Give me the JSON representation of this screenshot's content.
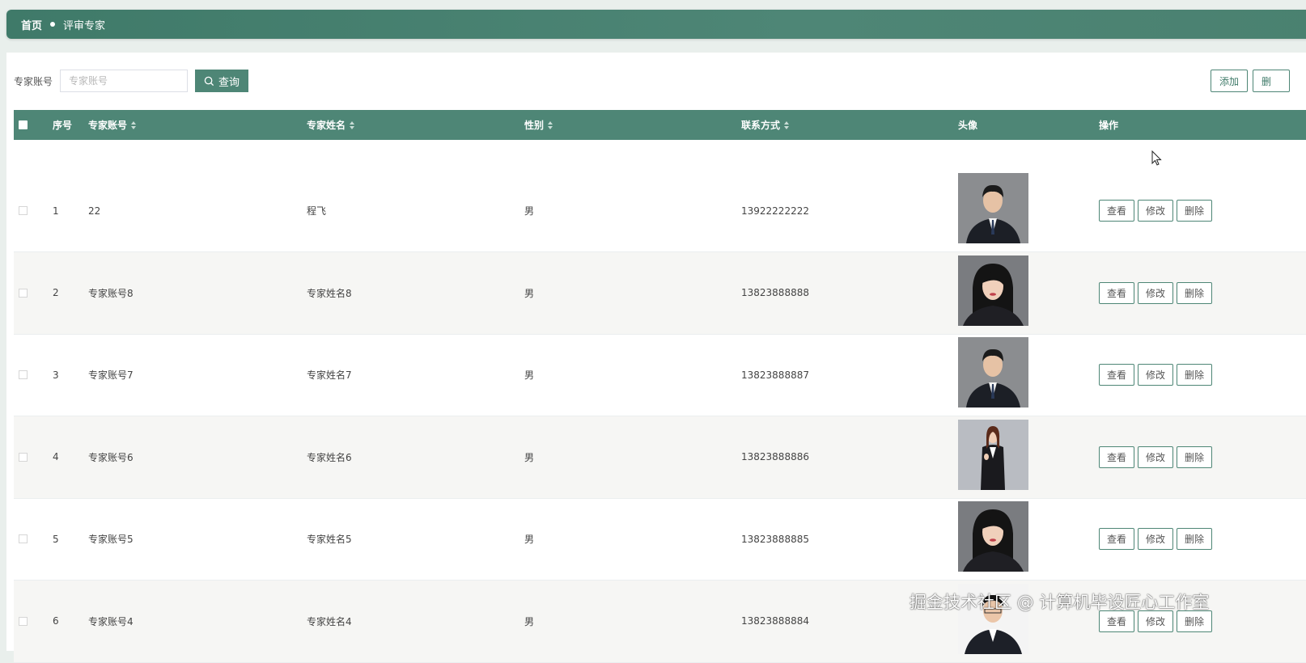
{
  "breadcrumb": {
    "home": "首页",
    "current": "评审专家"
  },
  "search": {
    "label": "专家账号",
    "placeholder": "专家账号",
    "value": "",
    "button": "查询"
  },
  "toolbar": {
    "add": "添加",
    "delete": "删"
  },
  "table": {
    "headers": {
      "index": "序号",
      "account": "专家账号",
      "name": "专家姓名",
      "gender": "性别",
      "phone": "联系方式",
      "avatar": "头像",
      "actions": "操作"
    },
    "rows": [
      {
        "index": "1",
        "account": "22",
        "name": "程飞",
        "gender": "男",
        "phone": "13922222222",
        "avatar": "male"
      },
      {
        "index": "2",
        "account": "专家账号8",
        "name": "专家姓名8",
        "gender": "男",
        "phone": "13823888888",
        "avatar": "female"
      },
      {
        "index": "3",
        "account": "专家账号7",
        "name": "专家姓名7",
        "gender": "男",
        "phone": "13823888887",
        "avatar": "male"
      },
      {
        "index": "4",
        "account": "专家账号6",
        "name": "专家姓名6",
        "gender": "男",
        "phone": "13823888886",
        "avatar": "female-full"
      },
      {
        "index": "5",
        "account": "专家账号5",
        "name": "专家姓名5",
        "gender": "男",
        "phone": "13823888885",
        "avatar": "female"
      },
      {
        "index": "6",
        "account": "专家账号4",
        "name": "专家姓名4",
        "gender": "男",
        "phone": "13823888884",
        "avatar": "male-light"
      }
    ],
    "actions": {
      "view": "查看",
      "edit": "修改",
      "delete": "删除"
    }
  },
  "watermark": "掘金技术社区 @ 计算机毕设匠心工作室",
  "colors": {
    "primary": "#4e8676",
    "header_bg": "#3f7a69",
    "alt_row": "#f6f6f4"
  }
}
